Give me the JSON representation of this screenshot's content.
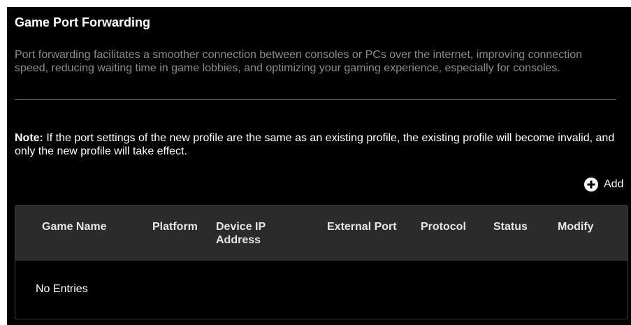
{
  "section": {
    "title": "Game Port Forwarding",
    "description": "Port forwarding facilitates a smoother connection between consoles or PCs over the internet, improving connection speed, reducing waiting time in game lobbies, and optimizing your gaming experience, especially for consoles."
  },
  "note": {
    "label": "Note:",
    "text": " If the port settings of the new profile are the same as an existing profile, the existing profile will become invalid, and only the new profile will take effect."
  },
  "toolbar": {
    "add_label": "Add",
    "add_icon": "plus-circle-icon"
  },
  "table": {
    "columns": [
      "Game Name",
      "Platform",
      "Device IP Address",
      "External Port",
      "Protocol",
      "Status",
      "Modify"
    ],
    "empty_text": "No Entries"
  },
  "colors": {
    "background": "#000000",
    "header_row": "#2b2b2b",
    "muted_text": "#8c8c8c",
    "text": "#ffffff"
  }
}
